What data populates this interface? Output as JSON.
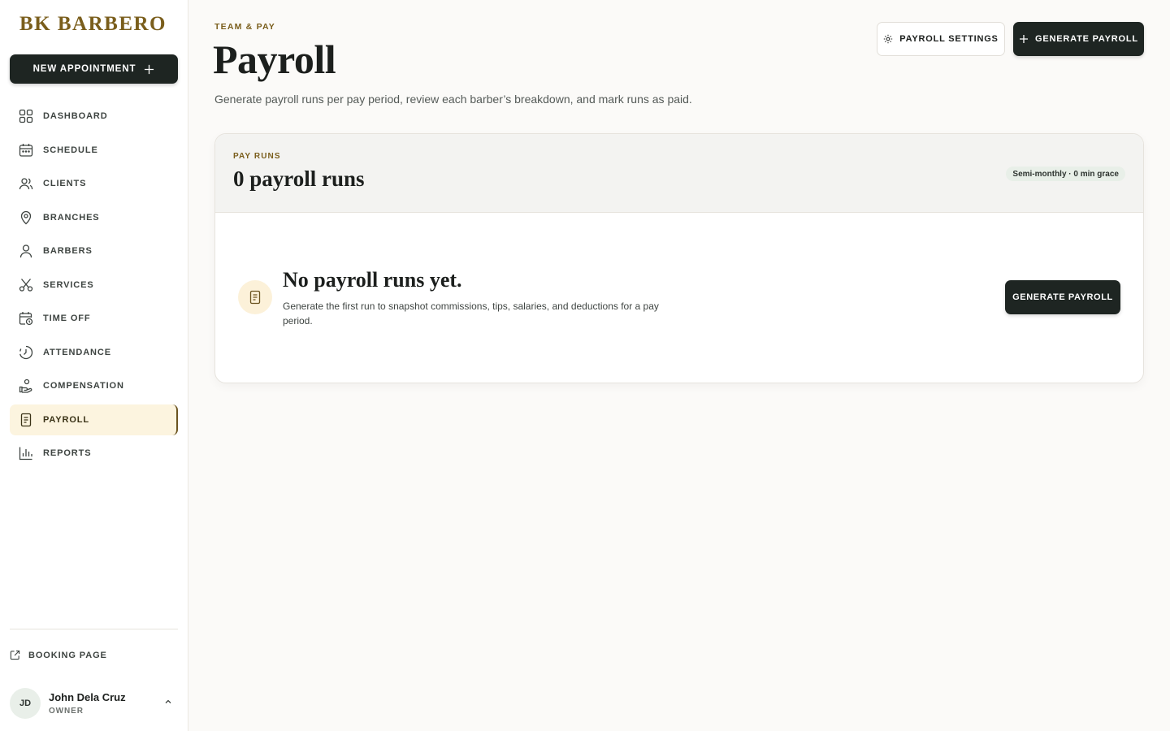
{
  "brand": "BK BARBERO",
  "sidebar": {
    "new_appointment": "NEW APPOINTMENT",
    "items": [
      {
        "label": "DASHBOARD",
        "icon": "grid-icon"
      },
      {
        "label": "SCHEDULE",
        "icon": "calendar-icon"
      },
      {
        "label": "CLIENTS",
        "icon": "users-icon"
      },
      {
        "label": "BRANCHES",
        "icon": "map-pin-icon"
      },
      {
        "label": "BARBERS",
        "icon": "user-icon"
      },
      {
        "label": "SERVICES",
        "icon": "scissors-icon"
      },
      {
        "label": "TIME OFF",
        "icon": "calendar-clock-icon"
      },
      {
        "label": "ATTENDANCE",
        "icon": "clock-icon"
      },
      {
        "label": "COMPENSATION",
        "icon": "hand-coins-icon"
      },
      {
        "label": "PAYROLL",
        "icon": "receipt-icon",
        "active": true
      },
      {
        "label": "REPORTS",
        "icon": "bar-chart-icon"
      }
    ],
    "booking_page": "BOOKING PAGE",
    "user": {
      "initials": "JD",
      "name": "John Dela Cruz",
      "role": "OWNER"
    }
  },
  "header": {
    "eyebrow": "TEAM & PAY",
    "title": "Payroll",
    "subtitle": "Generate payroll runs per pay period, review each barber’s breakdown, and mark runs as paid.",
    "settings_button": "PAYROLL SETTINGS",
    "generate_button": "GENERATE PAYROLL"
  },
  "card": {
    "eyebrow": "PAY RUNS",
    "title": "0 payroll runs",
    "pill": "Semi-monthly · 0 min grace",
    "empty_title": "No payroll runs yet.",
    "empty_desc": "Generate the first run to snapshot commissions, tips, salaries, and deductions for a pay period.",
    "empty_button": "GENERATE PAYROLL"
  },
  "colors": {
    "accent": "#7a5e1c",
    "dark": "#1e2522",
    "active_bg": "#fcf4df"
  }
}
